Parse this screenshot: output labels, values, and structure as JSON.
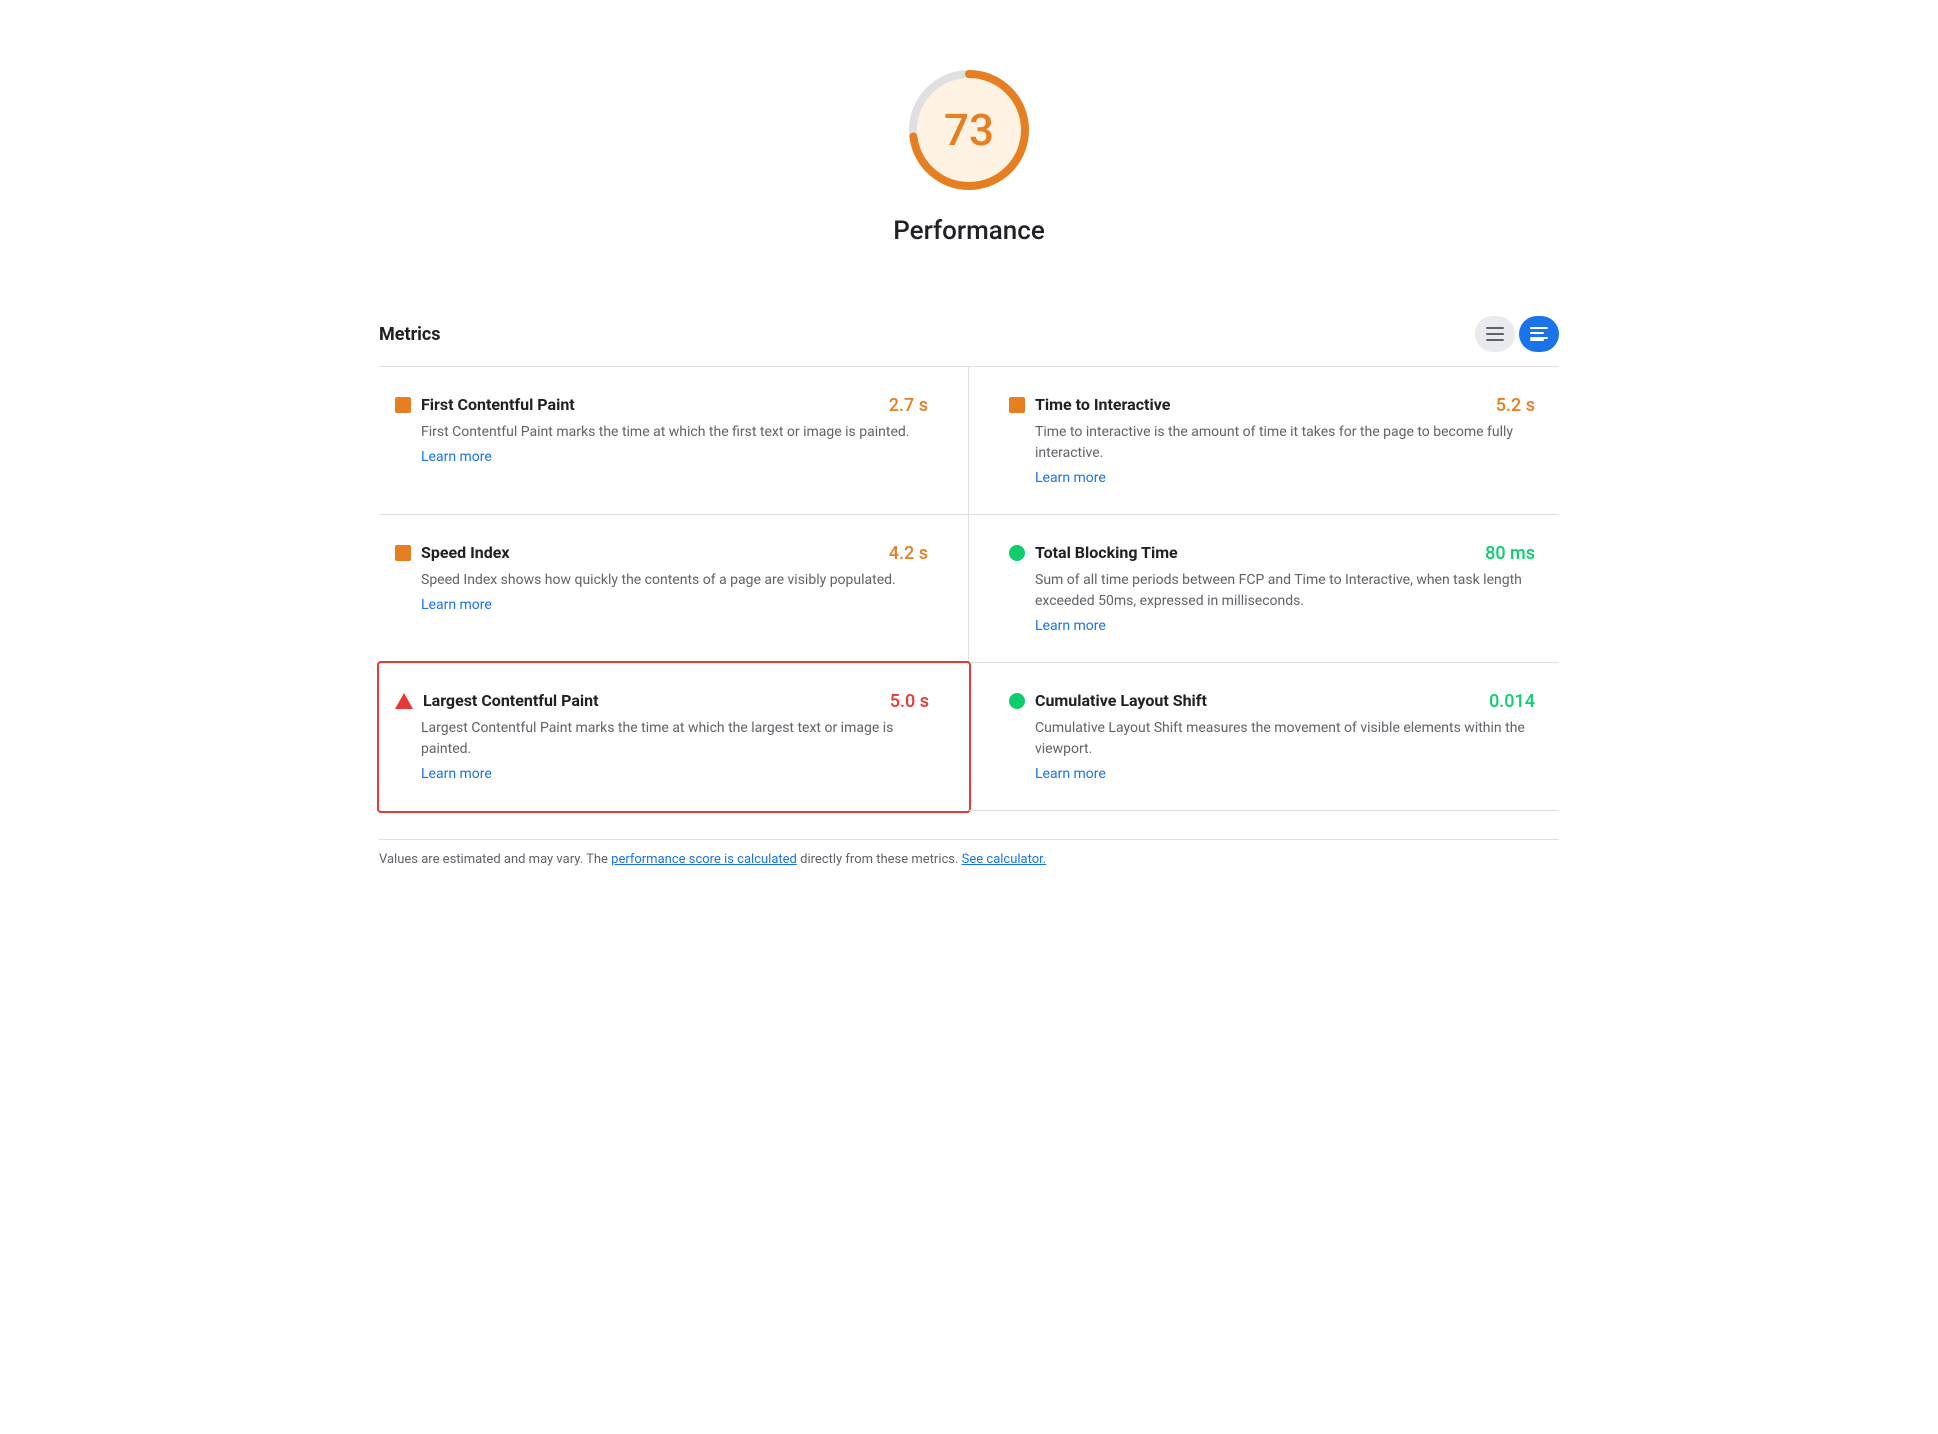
{
  "score": {
    "value": "73",
    "label": "Performance",
    "color": "#e67e22",
    "bg_color": "#fef3e2"
  },
  "metrics_section": {
    "title": "Metrics"
  },
  "metrics": [
    {
      "id": "fcp",
      "name": "First Contentful Paint",
      "value": "2.7 s",
      "value_color": "orange",
      "icon": "orange-square",
      "description": "First Contentful Paint marks the time at which the first text or image is painted.",
      "learn_more_text": "Learn more",
      "learn_more_url": "#",
      "highlighted": false
    },
    {
      "id": "tti",
      "name": "Time to Interactive",
      "value": "5.2 s",
      "value_color": "orange",
      "icon": "orange-square",
      "description": "Time to interactive is the amount of time it takes for the page to become fully interactive.",
      "learn_more_text": "Learn more",
      "learn_more_url": "#",
      "highlighted": false
    },
    {
      "id": "si",
      "name": "Speed Index",
      "value": "4.2 s",
      "value_color": "orange",
      "icon": "orange-square",
      "description": "Speed Index shows how quickly the contents of a page are visibly populated.",
      "learn_more_text": "Learn more",
      "learn_more_url": "#",
      "highlighted": false
    },
    {
      "id": "tbt",
      "name": "Total Blocking Time",
      "value": "80 ms",
      "value_color": "green",
      "icon": "green-circle",
      "description": "Sum of all time periods between FCP and Time to Interactive, when task length exceeded 50ms, expressed in milliseconds.",
      "learn_more_text": "Learn more",
      "learn_more_url": "#",
      "highlighted": false
    },
    {
      "id": "lcp",
      "name": "Largest Contentful Paint",
      "value": "5.0 s",
      "value_color": "red",
      "icon": "red-triangle",
      "description": "Largest Contentful Paint marks the time at which the largest text or image is painted.",
      "learn_more_text": "Learn more",
      "learn_more_url": "#",
      "highlighted": true
    },
    {
      "id": "cls",
      "name": "Cumulative Layout Shift",
      "value": "0.014",
      "value_color": "green",
      "icon": "green-circle",
      "description": "Cumulative Layout Shift measures the movement of visible elements within the viewport.",
      "learn_more_text": "Learn more",
      "learn_more_url": "#",
      "highlighted": false
    }
  ],
  "footer": {
    "text_before": "Values are estimated and may vary. The ",
    "link1_text": "performance score is calculated",
    "link1_url": "#",
    "text_middle": " directly from these metrics. ",
    "link2_text": "See calculator.",
    "link2_url": "#"
  },
  "toggle": {
    "list_label": "List view",
    "detail_label": "Detail view"
  }
}
